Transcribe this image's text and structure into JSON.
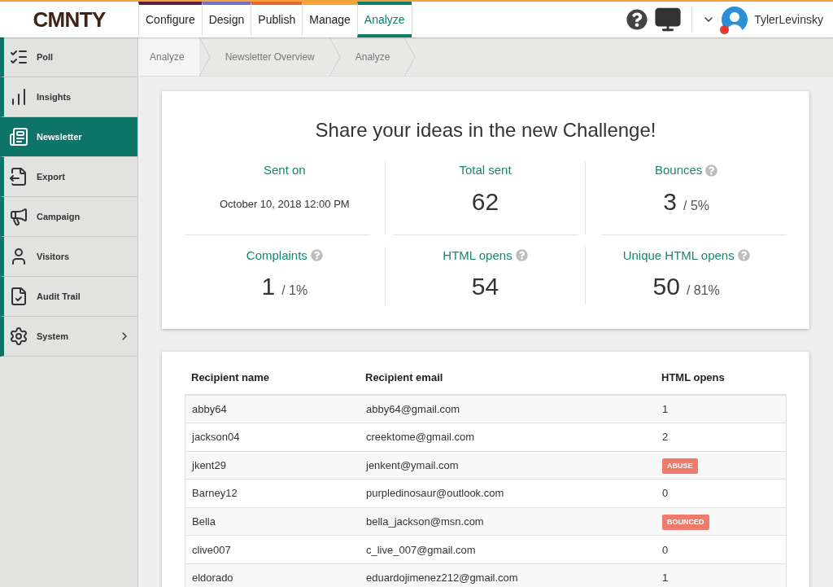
{
  "logo": "CMNTY",
  "tabs": [
    {
      "label": "Configure",
      "selected": false,
      "color": "#5b1a3e"
    },
    {
      "label": "Design",
      "selected": false,
      "color": "#7a6fbf"
    },
    {
      "label": "Publish",
      "selected": false,
      "color": "#e8672b"
    },
    {
      "label": "Manage",
      "selected": false,
      "color": "#f3a33a"
    },
    {
      "label": "Analyze",
      "selected": true,
      "color": "#0f7c6c"
    }
  ],
  "user": {
    "name": "TylerLevinsky",
    "notification": true
  },
  "sidebar": {
    "items": [
      {
        "label": "Poll",
        "selected": false,
        "submenu": false
      },
      {
        "label": "Insights",
        "selected": false,
        "submenu": false
      },
      {
        "label": "Newsletter",
        "selected": true,
        "submenu": false
      },
      {
        "label": "Export",
        "selected": false,
        "submenu": false
      },
      {
        "label": "Campaign",
        "selected": false,
        "submenu": false
      },
      {
        "label": "Visitors",
        "selected": false,
        "submenu": false
      },
      {
        "label": "Audit Trail",
        "selected": false,
        "submenu": false
      },
      {
        "label": "System",
        "selected": false,
        "submenu": true
      }
    ]
  },
  "breadcrumbs": [
    "Analyze",
    "Newsletter Overview",
    "Analyze"
  ],
  "summary": {
    "title": "Share your ideas in the new Challenge!",
    "stats": [
      {
        "label": "Sent on",
        "help": false,
        "kind": "date",
        "value": "October 10, 2018 12:00 PM"
      },
      {
        "label": "Total sent",
        "help": false,
        "kind": "number",
        "value": "62"
      },
      {
        "label": "Bounces",
        "help": true,
        "kind": "number",
        "value": "3",
        "suffix": "/ 5%"
      },
      {
        "label": "Complaints",
        "help": true,
        "kind": "number",
        "value": "1",
        "suffix": "/ 1%"
      },
      {
        "label": "HTML opens",
        "help": true,
        "kind": "number",
        "value": "54"
      },
      {
        "label": "Unique HTML opens",
        "help": true,
        "kind": "number",
        "value": "50",
        "suffix": "/ 81%"
      }
    ]
  },
  "table": {
    "columns": [
      "Recipient name",
      "Recipient email",
      "HTML opens"
    ],
    "rows": [
      {
        "name": "abby64",
        "email": "abby64@gmail.com",
        "opens": "1",
        "kind": "count"
      },
      {
        "name": "jackson04",
        "email": "creektome@gmail.com",
        "opens": "2",
        "kind": "count"
      },
      {
        "name": "jkent29",
        "email": "jenkent@ymail.com",
        "opens": "ABUSE",
        "kind": "badge"
      },
      {
        "name": "Barney12",
        "email": "purpledinosaur@outlook.com",
        "opens": "0",
        "kind": "count"
      },
      {
        "name": "Bella",
        "email": "bella_jackson@msn.com",
        "opens": "BOUNCED",
        "kind": "badge"
      },
      {
        "name": "clive007",
        "email": "c_live_007@gmail.com",
        "opens": "0",
        "kind": "count"
      },
      {
        "name": "eldorado",
        "email": "eduardojimenez212@gmail.com",
        "opens": "1",
        "kind": "count"
      }
    ]
  }
}
